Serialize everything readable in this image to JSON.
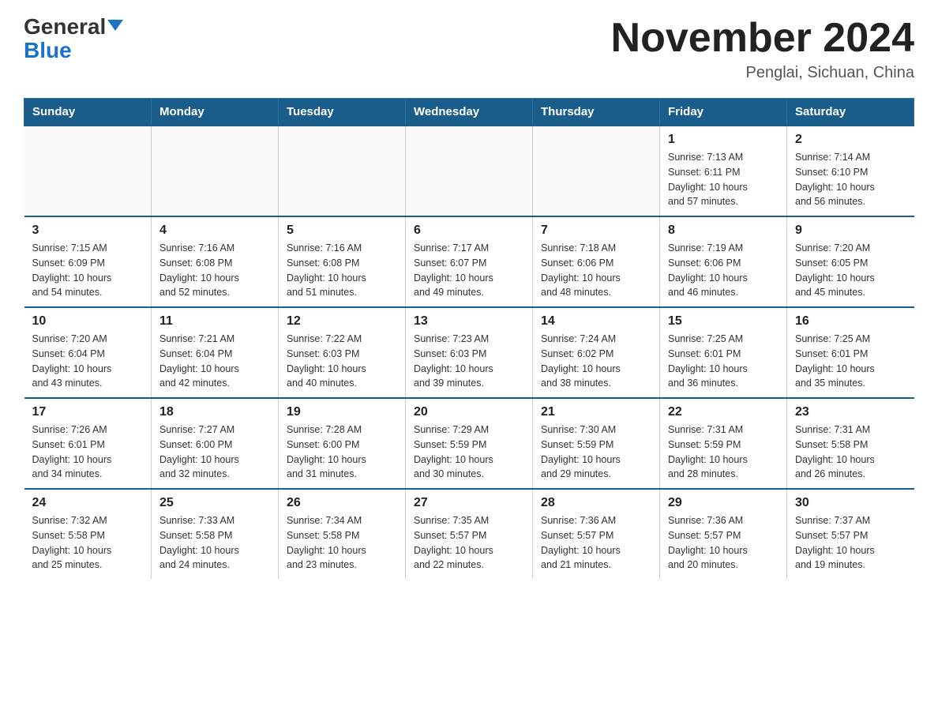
{
  "header": {
    "logo_general": "General",
    "logo_blue": "Blue",
    "title": "November 2024",
    "subtitle": "Penglai, Sichuan, China"
  },
  "weekdays": [
    "Sunday",
    "Monday",
    "Tuesday",
    "Wednesday",
    "Thursday",
    "Friday",
    "Saturday"
  ],
  "weeks": [
    [
      {
        "day": "",
        "info": ""
      },
      {
        "day": "",
        "info": ""
      },
      {
        "day": "",
        "info": ""
      },
      {
        "day": "",
        "info": ""
      },
      {
        "day": "",
        "info": ""
      },
      {
        "day": "1",
        "info": "Sunrise: 7:13 AM\nSunset: 6:11 PM\nDaylight: 10 hours\nand 57 minutes."
      },
      {
        "day": "2",
        "info": "Sunrise: 7:14 AM\nSunset: 6:10 PM\nDaylight: 10 hours\nand 56 minutes."
      }
    ],
    [
      {
        "day": "3",
        "info": "Sunrise: 7:15 AM\nSunset: 6:09 PM\nDaylight: 10 hours\nand 54 minutes."
      },
      {
        "day": "4",
        "info": "Sunrise: 7:16 AM\nSunset: 6:08 PM\nDaylight: 10 hours\nand 52 minutes."
      },
      {
        "day": "5",
        "info": "Sunrise: 7:16 AM\nSunset: 6:08 PM\nDaylight: 10 hours\nand 51 minutes."
      },
      {
        "day": "6",
        "info": "Sunrise: 7:17 AM\nSunset: 6:07 PM\nDaylight: 10 hours\nand 49 minutes."
      },
      {
        "day": "7",
        "info": "Sunrise: 7:18 AM\nSunset: 6:06 PM\nDaylight: 10 hours\nand 48 minutes."
      },
      {
        "day": "8",
        "info": "Sunrise: 7:19 AM\nSunset: 6:06 PM\nDaylight: 10 hours\nand 46 minutes."
      },
      {
        "day": "9",
        "info": "Sunrise: 7:20 AM\nSunset: 6:05 PM\nDaylight: 10 hours\nand 45 minutes."
      }
    ],
    [
      {
        "day": "10",
        "info": "Sunrise: 7:20 AM\nSunset: 6:04 PM\nDaylight: 10 hours\nand 43 minutes."
      },
      {
        "day": "11",
        "info": "Sunrise: 7:21 AM\nSunset: 6:04 PM\nDaylight: 10 hours\nand 42 minutes."
      },
      {
        "day": "12",
        "info": "Sunrise: 7:22 AM\nSunset: 6:03 PM\nDaylight: 10 hours\nand 40 minutes."
      },
      {
        "day": "13",
        "info": "Sunrise: 7:23 AM\nSunset: 6:03 PM\nDaylight: 10 hours\nand 39 minutes."
      },
      {
        "day": "14",
        "info": "Sunrise: 7:24 AM\nSunset: 6:02 PM\nDaylight: 10 hours\nand 38 minutes."
      },
      {
        "day": "15",
        "info": "Sunrise: 7:25 AM\nSunset: 6:01 PM\nDaylight: 10 hours\nand 36 minutes."
      },
      {
        "day": "16",
        "info": "Sunrise: 7:25 AM\nSunset: 6:01 PM\nDaylight: 10 hours\nand 35 minutes."
      }
    ],
    [
      {
        "day": "17",
        "info": "Sunrise: 7:26 AM\nSunset: 6:01 PM\nDaylight: 10 hours\nand 34 minutes."
      },
      {
        "day": "18",
        "info": "Sunrise: 7:27 AM\nSunset: 6:00 PM\nDaylight: 10 hours\nand 32 minutes."
      },
      {
        "day": "19",
        "info": "Sunrise: 7:28 AM\nSunset: 6:00 PM\nDaylight: 10 hours\nand 31 minutes."
      },
      {
        "day": "20",
        "info": "Sunrise: 7:29 AM\nSunset: 5:59 PM\nDaylight: 10 hours\nand 30 minutes."
      },
      {
        "day": "21",
        "info": "Sunrise: 7:30 AM\nSunset: 5:59 PM\nDaylight: 10 hours\nand 29 minutes."
      },
      {
        "day": "22",
        "info": "Sunrise: 7:31 AM\nSunset: 5:59 PM\nDaylight: 10 hours\nand 28 minutes."
      },
      {
        "day": "23",
        "info": "Sunrise: 7:31 AM\nSunset: 5:58 PM\nDaylight: 10 hours\nand 26 minutes."
      }
    ],
    [
      {
        "day": "24",
        "info": "Sunrise: 7:32 AM\nSunset: 5:58 PM\nDaylight: 10 hours\nand 25 minutes."
      },
      {
        "day": "25",
        "info": "Sunrise: 7:33 AM\nSunset: 5:58 PM\nDaylight: 10 hours\nand 24 minutes."
      },
      {
        "day": "26",
        "info": "Sunrise: 7:34 AM\nSunset: 5:58 PM\nDaylight: 10 hours\nand 23 minutes."
      },
      {
        "day": "27",
        "info": "Sunrise: 7:35 AM\nSunset: 5:57 PM\nDaylight: 10 hours\nand 22 minutes."
      },
      {
        "day": "28",
        "info": "Sunrise: 7:36 AM\nSunset: 5:57 PM\nDaylight: 10 hours\nand 21 minutes."
      },
      {
        "day": "29",
        "info": "Sunrise: 7:36 AM\nSunset: 5:57 PM\nDaylight: 10 hours\nand 20 minutes."
      },
      {
        "day": "30",
        "info": "Sunrise: 7:37 AM\nSunset: 5:57 PM\nDaylight: 10 hours\nand 19 minutes."
      }
    ]
  ]
}
